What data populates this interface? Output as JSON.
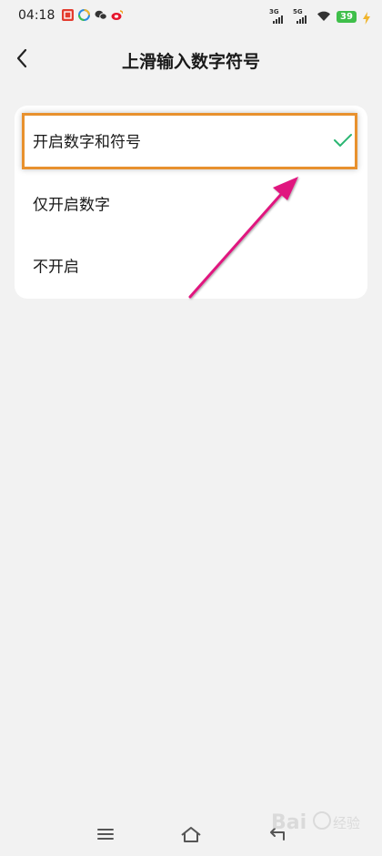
{
  "status_bar": {
    "time": "04:18",
    "network_1": "3G",
    "network_2": "5G",
    "battery": "39",
    "battery_color": "#3fbf4a"
  },
  "header": {
    "title": "上滑输入数字符号",
    "back_icon": "chevron-left-icon"
  },
  "options": [
    {
      "label": "开启数字和符号",
      "selected": true
    },
    {
      "label": "仅开启数字",
      "selected": false
    },
    {
      "label": "不开启",
      "selected": false
    }
  ],
  "colors": {
    "check": "#2bb673",
    "highlight": "#e8912e",
    "arrow": "#e0167f"
  },
  "nav_bar": {
    "icons": [
      "menu-icon",
      "home-icon",
      "back-icon"
    ]
  }
}
